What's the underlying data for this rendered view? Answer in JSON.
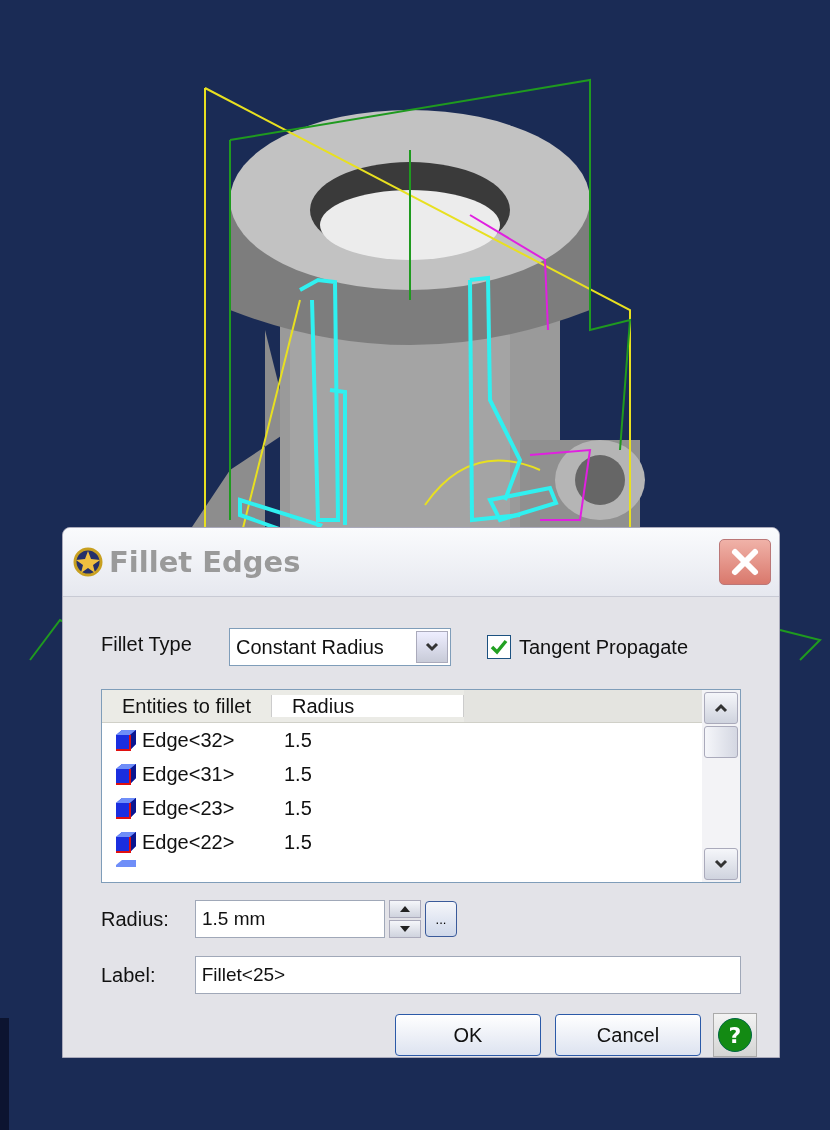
{
  "dialog": {
    "title": "Fillet Edges",
    "fillet_type": {
      "label": "Fillet Type",
      "value": "Constant Radius"
    },
    "tangent_propagate": {
      "label": "Tangent Propagate",
      "checked": true
    },
    "list": {
      "columns": [
        "Entities to fillet",
        "Radius"
      ],
      "rows": [
        {
          "entity": "Edge<32>",
          "radius": "1.5"
        },
        {
          "entity": "Edge<31>",
          "radius": "1.5"
        },
        {
          "entity": "Edge<23>",
          "radius": "1.5"
        },
        {
          "entity": "Edge<22>",
          "radius": "1.5"
        }
      ]
    },
    "radius": {
      "label": "Radius:",
      "value": "1.5 mm",
      "browse": "..."
    },
    "label_field": {
      "label": "Label:",
      "value": "Fillet<25>"
    },
    "buttons": [
      "OK",
      "Cancel"
    ],
    "help": "?"
  }
}
